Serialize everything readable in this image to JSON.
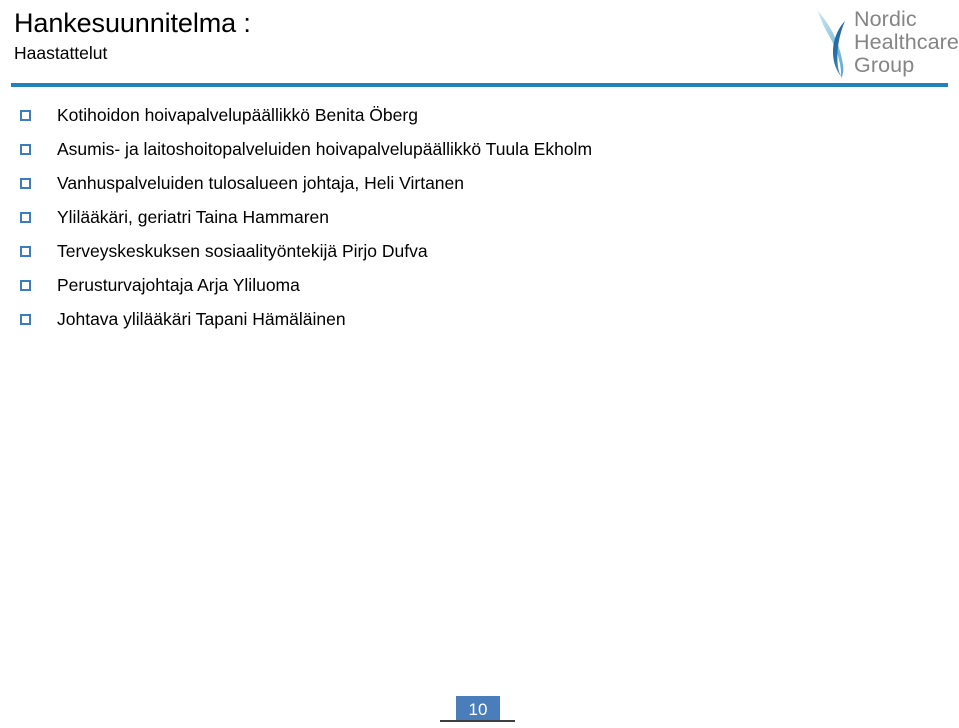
{
  "slide": {
    "title": "Hankesuunnitelma :",
    "subtitle": "Haastattelut",
    "page_number": "10"
  },
  "logo": {
    "mark_name": "nordic-healthcare-group-swoosh",
    "line1": "Nordic",
    "line2": "Healthcare",
    "line3": "Group",
    "text_color": "#858585",
    "mark_color_dark": "#2b6ea3",
    "mark_color_light": "#7fc3e0"
  },
  "colors": {
    "rule": "#2283b8",
    "bullet": "#3c7ebc",
    "page_box": "#4a7ebb",
    "page_rule": "#3f3f3f",
    "text": "#000000"
  },
  "bullets": [
    {
      "marker_name": "bullet-square-icon",
      "text": "Kotihoidon hoivapalvelupäällikkö Benita Öberg"
    },
    {
      "marker_name": "bullet-square-icon",
      "text": "Asumis- ja laitoshoitopalveluiden hoivapalvelupäällikkö Tuula Ekholm"
    },
    {
      "marker_name": "bullet-square-icon",
      "text": "Vanhuspalveluiden tulosalueen johtaja, Heli Virtanen"
    },
    {
      "marker_name": "bullet-square-icon",
      "text": "Ylilääkäri, geriatri Taina Hammaren"
    },
    {
      "marker_name": "bullet-square-icon",
      "text": "Terveyskeskuksen sosiaalityöntekijä Pirjo Dufva"
    },
    {
      "marker_name": "bullet-square-icon",
      "text": "Perusturvajohtaja Arja Yliluoma"
    },
    {
      "marker_name": "bullet-square-icon",
      "text": "Johtava ylilääkäri Tapani  Hämäläinen"
    }
  ]
}
